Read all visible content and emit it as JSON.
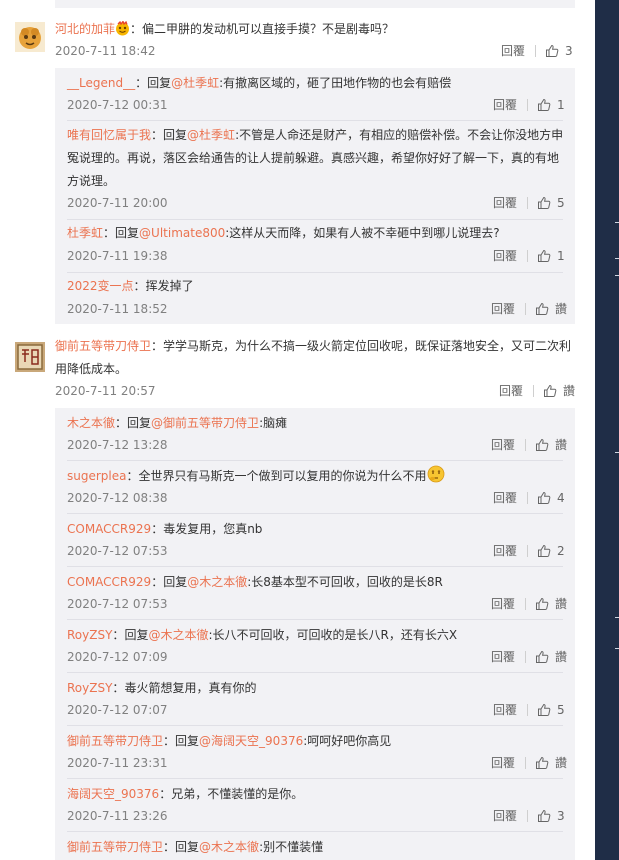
{
  "actions": {
    "reply_label": "回覆",
    "like_label": "讚"
  },
  "comments": [
    {
      "user": "河北的加菲",
      "text": "：偏二甲肼的发动机可以直接手摸？不是剧毒吗？",
      "time": "2020-7-11 18:42",
      "likes": "3",
      "replies": [
        {
          "user": "__Legend__",
          "sep": "：",
          "reply_prefix": "回复",
          "mention": "@杜季虹",
          "text": ":有撤离区域的，砸了田地作物的也会有赔偿",
          "time": "2020-7-12 00:31",
          "likes": "1"
        },
        {
          "user": "唯有回忆属于我",
          "sep": "：",
          "reply_prefix": "回复",
          "mention": "@杜季虹",
          "text": ":不管是人命还是财产，有相应的赔偿补偿。不会让你没地方申冤说理的。再说，落区会给通告的让人提前躲避。真感兴趣，希望你好好了解一下，真的有地方说理。",
          "time": "2020-7-11 20:00",
          "likes": "5"
        },
        {
          "user": "杜季虹",
          "sep": "：",
          "reply_prefix": "回复",
          "mention": "@Ultimate800",
          "text": ":这样从天而降，如果有人被不幸砸中到哪儿说理去?",
          "time": "2020-7-11 19:38",
          "likes": "1"
        },
        {
          "user": "2022变一点",
          "sep": "：",
          "text": "挥发掉了",
          "time": "2020-7-11 18:52",
          "likes": "讚"
        }
      ]
    },
    {
      "user": "御前五等带刀侍卫",
      "text": "：学学马斯克，为什么不搞一级火箭定位回收呢，既保证落地安全，又可二次利用降低成本。",
      "time": "2020-7-11 20:57",
      "likes": "讚",
      "replies": [
        {
          "user": "木之本徹",
          "sep": "：",
          "reply_prefix": "回复",
          "mention": "@御前五等带刀侍卫",
          "text": ":脑瘫",
          "time": "2020-7-12 13:28",
          "likes": "讚"
        },
        {
          "user": "sugerplea",
          "sep": "：",
          "text": "全世界只有马斯克一个做到可以复用的你说为什么不用",
          "emoji": "thinking-face-icon",
          "time": "2020-7-12 08:38",
          "likes": "4"
        },
        {
          "user": "COMACCR929",
          "sep": "：",
          "text": "毒发复用，您真nb",
          "time": "2020-7-12 07:53",
          "likes": "2"
        },
        {
          "user": "COMACCR929",
          "sep": "：",
          "reply_prefix": "回复",
          "mention": "@木之本徹",
          "text": ":长8基本型不可回收，回收的是长8R",
          "time": "2020-7-12 07:53",
          "likes": "讚"
        },
        {
          "user": "RoyZSY",
          "sep": "：",
          "reply_prefix": "回复",
          "mention": "@木之本徹",
          "text": ":长八不可回收，可回收的是长八R，还有长六X",
          "time": "2020-7-12 07:09",
          "likes": "讚"
        },
        {
          "user": "RoyZSY",
          "sep": "：",
          "text": "毒火箭想复用，真有你的",
          "time": "2020-7-12 07:07",
          "likes": "5"
        },
        {
          "user": "御前五等带刀侍卫",
          "sep": "：",
          "reply_prefix": "回复",
          "mention": "@海阔天空_90376",
          "text": ":呵呵好吧你高见",
          "time": "2020-7-11 23:31",
          "likes": "讚"
        },
        {
          "user": "海阔天空_90376",
          "sep": "：",
          "text": "兄弟，不懂装懂的是你。",
          "time": "2020-7-11 23:26",
          "likes": "3"
        },
        {
          "user": "御前五等带刀侍卫",
          "sep": "：",
          "reply_prefix": "回复",
          "mention": "@木之本徹",
          "text": ":别不懂装懂",
          "time": "",
          "likes": ""
        }
      ]
    }
  ],
  "colors": {
    "username": "#eb7350",
    "meta": "#808080",
    "reply_bg": "#f2f2f5",
    "sidebar": "#1f2d47"
  }
}
